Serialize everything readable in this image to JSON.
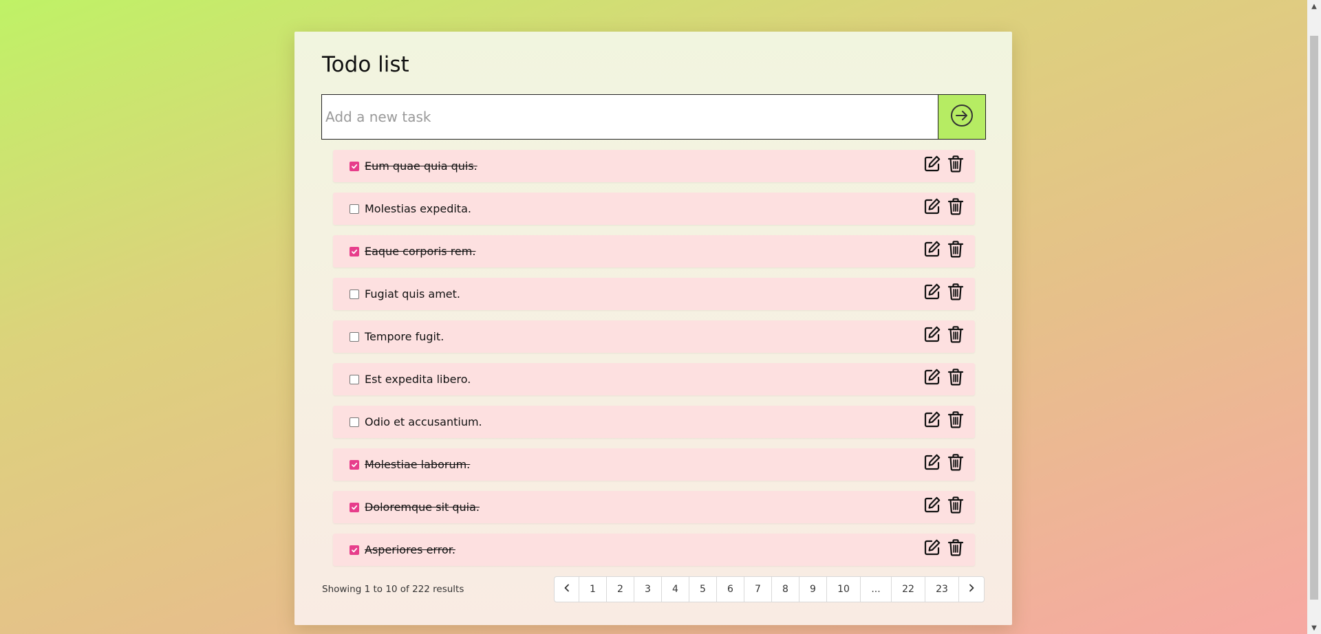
{
  "app": {
    "title": "Todo list"
  },
  "add_task": {
    "placeholder": "Add a new task",
    "submit_icon": "arrow-right-circle-icon"
  },
  "tasks": [
    {
      "text": "Eum quae quia quis.",
      "done": true
    },
    {
      "text": "Molestias expedita.",
      "done": false
    },
    {
      "text": "Eaque corporis rem.",
      "done": true
    },
    {
      "text": "Fugiat quis amet.",
      "done": false
    },
    {
      "text": "Tempore fugit.",
      "done": false
    },
    {
      "text": "Est expedita libero.",
      "done": false
    },
    {
      "text": "Odio et accusantium.",
      "done": false
    },
    {
      "text": "Molestiae laborum.",
      "done": true
    },
    {
      "text": "Doloremque sit quia.",
      "done": true
    },
    {
      "text": "Asperiores error.",
      "done": true
    }
  ],
  "pagination": {
    "summary": "Showing 1 to 10 of 222 results",
    "pages": [
      "1",
      "2",
      "3",
      "4",
      "5",
      "6",
      "7",
      "8",
      "9",
      "10",
      "...",
      "22",
      "23"
    ]
  },
  "colors": {
    "accent_green": "#b6ec63",
    "checkbox_checked": "#e73d8b",
    "task_background": "#fde0e0"
  }
}
